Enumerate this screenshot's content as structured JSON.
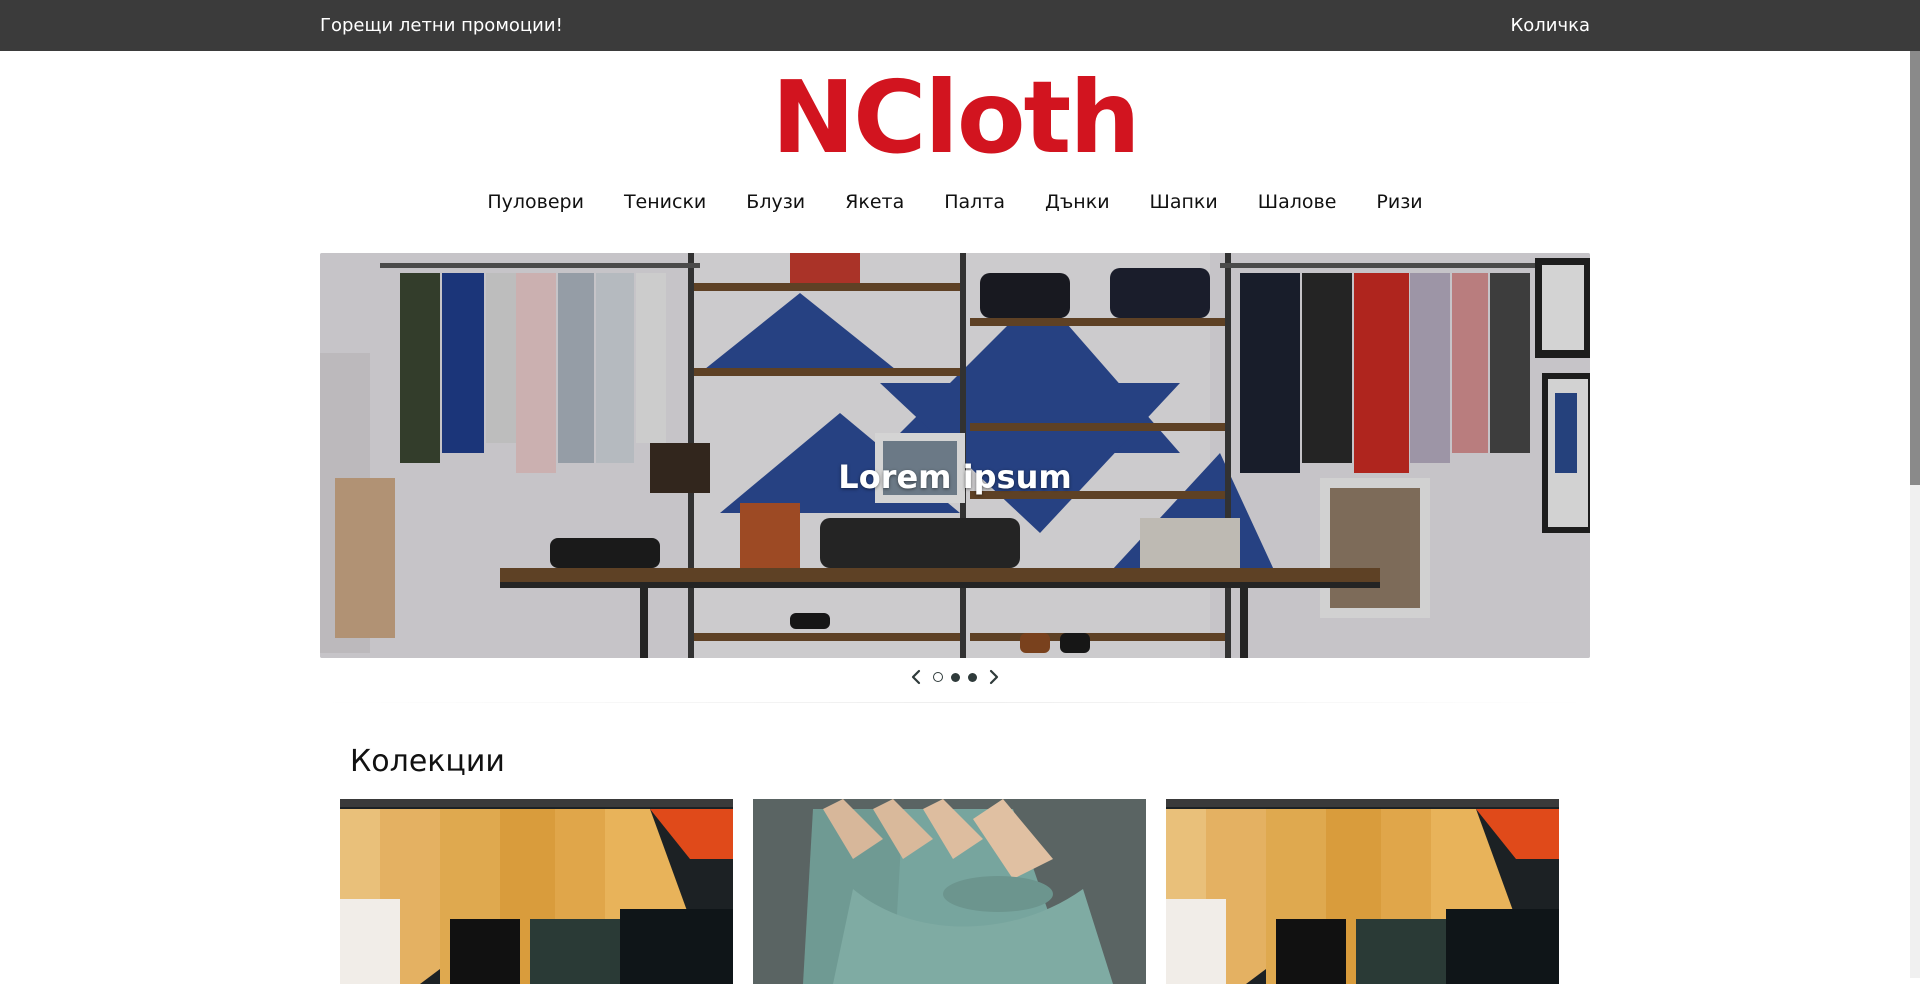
{
  "topbar": {
    "promo_text": "Горещи летни промоции!",
    "cart_label": "Количка"
  },
  "brand": {
    "logo_text": "NCloth",
    "color": "#d2141f"
  },
  "nav": {
    "items": [
      "Пуловери",
      "Тениски",
      "Блузи",
      "Якета",
      "Палта",
      "Дънки",
      "Шапки",
      "Шалове",
      "Ризи"
    ]
  },
  "hero": {
    "caption": "Lorem ipsum",
    "slides_count": 3,
    "active_slide": 1
  },
  "collections": {
    "title": "Колекции"
  },
  "icons": {
    "prev": "chevron-left-icon",
    "next": "chevron-right-icon"
  }
}
